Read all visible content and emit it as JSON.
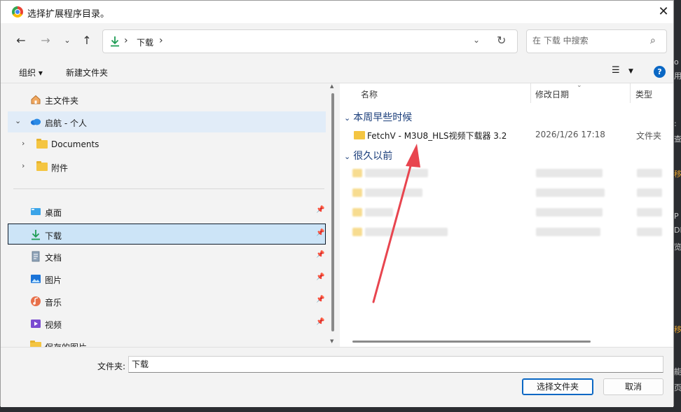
{
  "title": "选择扩展程序目录。",
  "address": {
    "crumb": "下载"
  },
  "search": {
    "placeholder": "在 下载 中搜索"
  },
  "toolbar": {
    "organize": "组织 ▾",
    "new_folder": "新建文件夹"
  },
  "sidebar": {
    "items": [
      {
        "label": "主文件夹"
      },
      {
        "label": "启航 - 个人"
      },
      {
        "label": "Documents"
      },
      {
        "label": "附件"
      },
      {
        "label": "桌面"
      },
      {
        "label": "下载"
      },
      {
        "label": "文档"
      },
      {
        "label": "图片"
      },
      {
        "label": "音乐"
      },
      {
        "label": "视频"
      },
      {
        "label": "保存的图片"
      }
    ]
  },
  "columns": {
    "name": "名称",
    "date": "修改日期",
    "type": "类型"
  },
  "groups": [
    {
      "label": "本周早些时候"
    },
    {
      "label": "很久以前"
    }
  ],
  "files": [
    {
      "name": "FetchV - M3U8_HLS视频下载器 3.2",
      "date": "2026/1/26 17:18",
      "type": "文件夹"
    }
  ],
  "footer": {
    "folder_label": "文件夹:",
    "folder_value": "下载",
    "select_button": "选择文件夹",
    "cancel_button": "取消"
  },
  "colors": {
    "accent": "#0a67c4",
    "selected_bg": "#cce4f7",
    "annotation_arrow": "#e8454f"
  }
}
